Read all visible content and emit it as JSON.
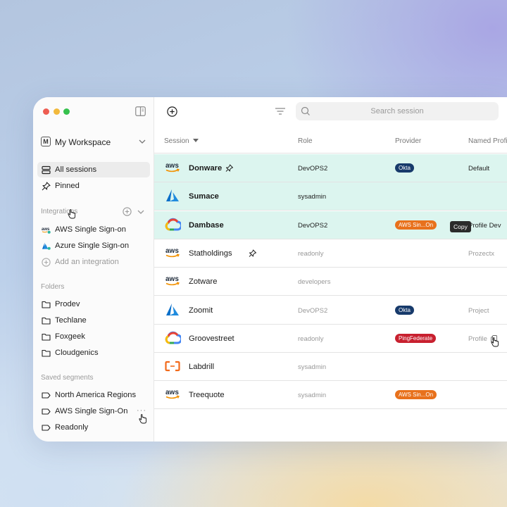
{
  "workspace": {
    "badge": "M",
    "name": "My Workspace"
  },
  "nav": {
    "all_sessions": "All sessions",
    "pinned": "Pinned"
  },
  "integrations": {
    "title": "Integrations",
    "items": [
      "AWS Single Sign-on",
      "Azure Single Sign-on"
    ],
    "add_label": "Add an integration"
  },
  "folders": {
    "title": "Folders",
    "items": [
      "Prodev",
      "Techlane",
      "Foxgeek",
      "Cloudgenics"
    ]
  },
  "segments": {
    "title": "Saved segments",
    "items": [
      "North America Regions",
      "AWS Single Sign-On",
      "Readonly"
    ],
    "more": "···"
  },
  "search": {
    "placeholder": "Search session"
  },
  "table": {
    "columns": [
      "Session",
      "Role",
      "Provider",
      "Named Profile"
    ],
    "rows": [
      {
        "logo": "aws",
        "session": "Donware",
        "role": "DevOPS2",
        "provider": "Okta",
        "provider_color": "#173a6b",
        "profile": "Default",
        "pinned": true,
        "highlighted": true
      },
      {
        "logo": "azure",
        "session": "Sumace",
        "role": "sysadmin",
        "provider": "",
        "profile": "",
        "pinned": false,
        "highlighted": true
      },
      {
        "logo": "gcp",
        "session": "Dambase",
        "role": "DevOPS2",
        "provider": "AWS Sin...On",
        "provider_color": "#e8711c",
        "profile": "Profile Dev",
        "pinned": false,
        "highlighted": true
      },
      {
        "logo": "aws",
        "session": "Statholdings",
        "role": "readonly",
        "provider": "",
        "profile": "Prozectx",
        "pinned": true,
        "highlighted": false
      },
      {
        "logo": "aws",
        "session": "Zotware",
        "role": "developers",
        "provider": "",
        "profile": "",
        "pinned": false,
        "highlighted": false
      },
      {
        "logo": "azure",
        "session": "Zoomit",
        "role": "DevOPS2",
        "provider": "Okta",
        "provider_color": "#173a6b",
        "profile": "Project",
        "pinned": false,
        "highlighted": false
      },
      {
        "logo": "gcp",
        "session": "Groovestreet",
        "role": "readonly",
        "provider": "PingFederate",
        "provider_color": "#c8202f",
        "profile": "Profile",
        "pinned": false,
        "highlighted": false
      },
      {
        "logo": "alibaba",
        "session": "Labdrill",
        "role": "sysadmin",
        "provider": "",
        "profile": "",
        "pinned": false,
        "highlighted": false
      },
      {
        "logo": "aws",
        "session": "Treequote",
        "role": "sysadmin",
        "provider": "AWS Sin...On",
        "provider_color": "#e8711c",
        "profile": "",
        "pinned": false,
        "highlighted": false
      }
    ]
  },
  "tooltip": {
    "copy": "Copy"
  },
  "colors": {
    "highlight_row": "#dcf5ef",
    "accent_teal": "#2bb5a0"
  },
  "icons": [
    "panel-toggle-icon",
    "chevron-down-icon",
    "sessions-stack-icon",
    "pin-icon",
    "plus-circle-icon",
    "filter-icon",
    "search-icon",
    "folder-icon",
    "segment-tag-icon",
    "copy-icon",
    "hand-cursor-icon"
  ]
}
